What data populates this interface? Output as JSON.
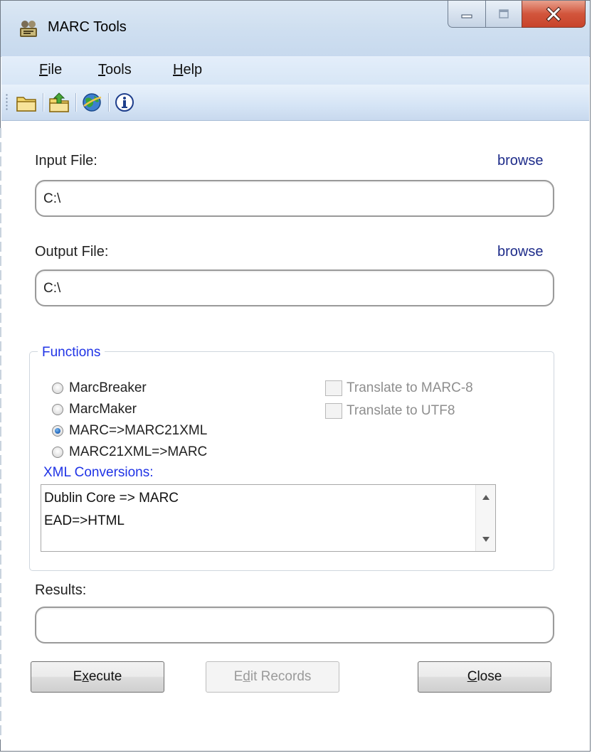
{
  "window": {
    "title": "MARC Tools",
    "icons": {
      "app": "marc-tools-app-icon",
      "minimize": "minimize-icon",
      "maximize": "maximize-icon",
      "close": "close-x-icon"
    }
  },
  "menu": {
    "items": [
      {
        "pre": "",
        "key": "F",
        "post": "ile"
      },
      {
        "pre": "",
        "key": "T",
        "post": "ools"
      },
      {
        "pre": "",
        "key": "H",
        "post": "elp"
      }
    ]
  },
  "toolbar": {
    "buttons": [
      "open-folder-icon",
      "upload-folder-icon",
      "globe-icon",
      "info-icon"
    ]
  },
  "input": {
    "label": "Input File:",
    "browse": "browse",
    "value": "C:\\"
  },
  "output": {
    "label": "Output File:",
    "browse": "browse",
    "value": "C:\\"
  },
  "functions": {
    "legend": "Functions",
    "options": [
      {
        "label": "MarcBreaker",
        "checked": false
      },
      {
        "label": "MarcMaker",
        "checked": false
      },
      {
        "label": "MARC=>MARC21XML",
        "checked": true
      },
      {
        "label": "MARC21XML=>MARC",
        "checked": false
      }
    ],
    "checkboxes": [
      {
        "label": "Translate to MARC-8",
        "checked": false,
        "disabled": true
      },
      {
        "label": "Translate to UTF8",
        "checked": false,
        "disabled": true
      }
    ],
    "xml_label": "XML Conversions:",
    "xml_items": [
      "Dublin Core => MARC",
      "EAD=>HTML"
    ]
  },
  "results": {
    "label": "Results:",
    "value": ""
  },
  "buttons": {
    "execute": {
      "pre": "",
      "key": "x",
      "post": "ecute",
      "first": "E"
    },
    "edit": {
      "pre": "E",
      "key": "d",
      "post": "it Records"
    },
    "close": {
      "pre": "",
      "key": "C",
      "post": "lose"
    }
  },
  "colors": {
    "accent_blue": "#1f33e6",
    "link": "#1e2c8a",
    "close_red": "#c8442b"
  }
}
